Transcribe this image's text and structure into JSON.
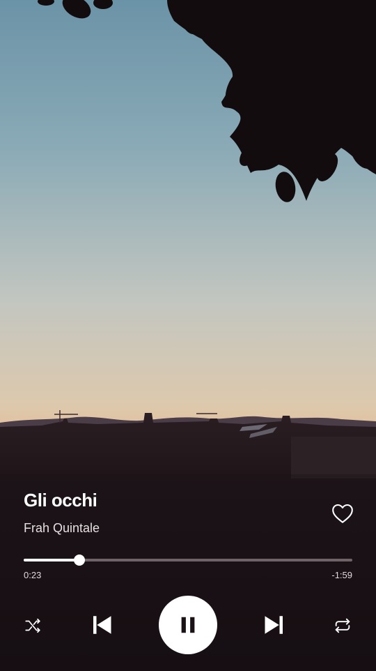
{
  "track": {
    "title": "Gli occhi",
    "artist": "Frah Quintale",
    "elapsed": "0:23",
    "remaining": "-1:59",
    "progress_fraction": 0.17,
    "liked": false
  },
  "controls": {
    "shuffle_icon": "shuffle-icon",
    "previous_icon": "skip-previous-icon",
    "play_pause_icon": "pause-icon",
    "next_icon": "skip-next-icon",
    "repeat_icon": "repeat-icon",
    "like_icon": "heart-icon"
  },
  "colors": {
    "sky_top": "#6f97aa",
    "sky_mid": "#d1c9b9",
    "horizon": "#ee8c56",
    "foreground": "#1c1418",
    "accent": "#ffffff"
  }
}
